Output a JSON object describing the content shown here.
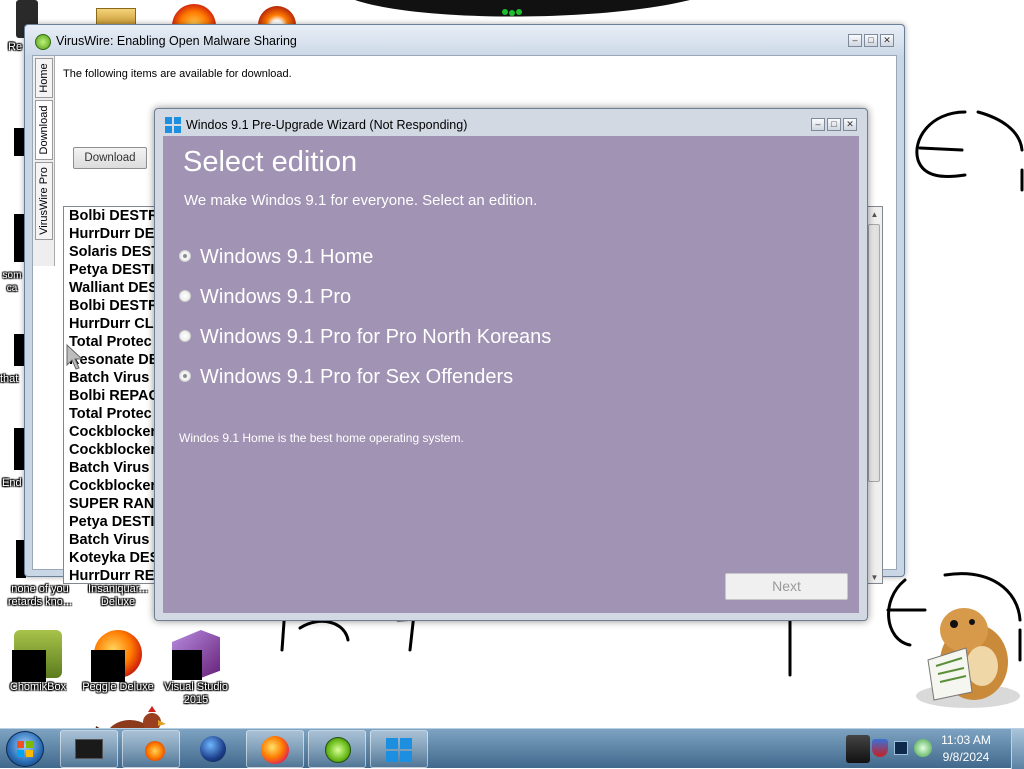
{
  "desktop": {
    "icons": [
      {
        "id": "recycle",
        "label": "Re"
      },
      {
        "id": "blank1",
        "label": ""
      },
      {
        "id": "some",
        "label": "som\nca"
      },
      {
        "id": "that",
        "label": "that"
      },
      {
        "id": "end",
        "label": "End"
      },
      {
        "id": "none-of-you",
        "label": "none of you retards kno..."
      },
      {
        "id": "insaniquar",
        "label": "Insaniquar... Deluxe"
      },
      {
        "id": "chomikbox",
        "label": "ChomikBox"
      },
      {
        "id": "peggle",
        "label": "Peggle Deluxe"
      },
      {
        "id": "vs2015",
        "label": "Visual Studio 2015"
      }
    ]
  },
  "viruswire": {
    "title": "VirusWire: Enabling Open Malware Sharing",
    "tabs": [
      "Home",
      "Download",
      "VirusWire Pro"
    ],
    "active_tab": "Download",
    "available_text": "The following items are available for download.",
    "download_button": "Download",
    "items": [
      "Bolbi DESTR",
      "HurrDurr DE",
      "Solaris DEST",
      "Petya DESTI",
      "Walliant DES",
      "Bolbi DESTR",
      "HurrDurr CL",
      "Total Protec",
      "Resonate DE",
      "Batch Virus I",
      "Bolbi REPAC",
      "Total Protec",
      "Cockblocker",
      "Cockblocker",
      "Batch Virus I",
      "Cockblocker",
      "SUPER RAN",
      "Petya DESTI",
      "Batch Virus I",
      "Koteyka DES",
      "HurrDurr RE"
    ]
  },
  "wizard": {
    "title": "Windos 9.1 Pre-Upgrade Wizard (Not Responding)",
    "heading": "Select edition",
    "subheading": "We make Windos 9.1 for everyone. Select an edition.",
    "options": [
      {
        "label": "Windows 9.1 Home",
        "selected": true
      },
      {
        "label": "Windows 9.1 Pro",
        "selected": false
      },
      {
        "label": "Windows 9.1 Pro for Pro North Koreans",
        "selected": false
      },
      {
        "label": "Windows 9.1 Pro for Sex Offenders",
        "selected": true
      }
    ],
    "description": "Windos 9.1 Home is the best home operating system.",
    "next_button": "Next"
  },
  "window_controls": {
    "minimize": "–",
    "maximize": "□",
    "close": "✕"
  },
  "taskbar": {
    "clock_time": "11:03 AM",
    "clock_date": "9/8/2024"
  },
  "colors": {
    "wizard_panel": "#a193b3",
    "taskbar": "#5f86a8",
    "window_frame": "#c9d6e5"
  }
}
